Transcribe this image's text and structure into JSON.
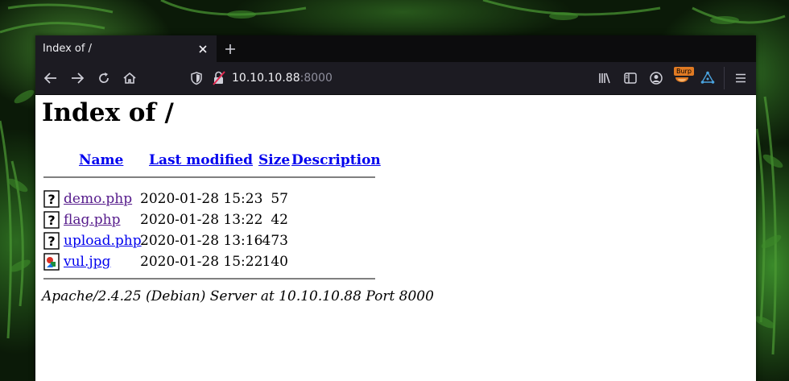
{
  "browser": {
    "tab": {
      "title": "Index of /"
    },
    "address": {
      "host": "10.10.10.88",
      "port": ":8000"
    },
    "toolbar": {
      "burp_label": "Burp"
    }
  },
  "page": {
    "heading": "Index of /",
    "columns": {
      "name": "Name",
      "modified": "Last modified",
      "size": "Size",
      "description": "Description"
    },
    "files": [
      {
        "name": "demo.php",
        "modified": "2020-01-28 15:23",
        "size": "57",
        "icon": "unknown-file-icon",
        "visited": true
      },
      {
        "name": "flag.php",
        "modified": "2020-01-28 13:22",
        "size": "42",
        "icon": "unknown-file-icon",
        "visited": true
      },
      {
        "name": "upload.php",
        "modified": "2020-01-28 13:16",
        "size": "473",
        "icon": "unknown-file-icon",
        "visited": false
      },
      {
        "name": "vul.jpg",
        "modified": "2020-01-28 15:22",
        "size": "140",
        "icon": "image-file-icon",
        "visited": false
      }
    ],
    "footer": "Apache/2.4.25 (Debian) Server at 10.10.10.88 Port 8000"
  },
  "colors": {
    "link": "#0000ee",
    "visited": "#551a8b",
    "chrome": "#1c1b22",
    "burp": "#e07a23"
  }
}
